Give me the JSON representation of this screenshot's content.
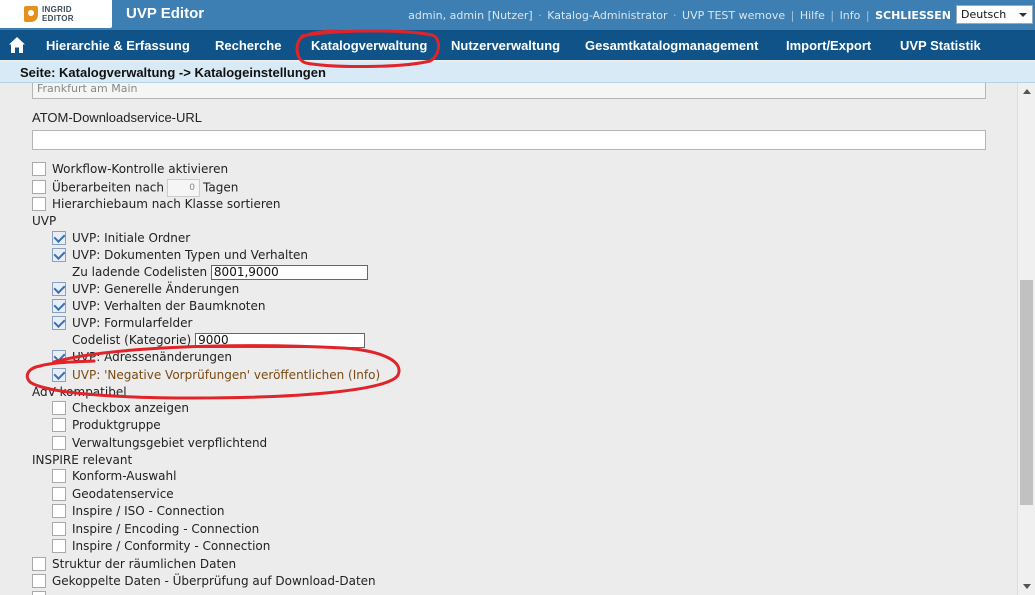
{
  "app": {
    "logo_line1": "INGRID",
    "logo_line2": "EDITOR",
    "title": "UVP Editor"
  },
  "header": {
    "user": "admin, admin [Nutzer]",
    "role": "Katalog-Administrator",
    "catalog": "UVP TEST wemove",
    "help": "Hilfe",
    "info": "Info",
    "close": "SCHLIESSEN",
    "language": "Deutsch"
  },
  "nav": {
    "items": [
      {
        "label": "Hierarchie & Erfassung"
      },
      {
        "label": "Recherche"
      },
      {
        "label": "Katalogverwaltung"
      },
      {
        "label": "Nutzerverwaltung"
      },
      {
        "label": "Gesamtkatalogmanagement"
      },
      {
        "label": "Import/Export"
      },
      {
        "label": "UVP Statistik"
      }
    ]
  },
  "breadcrumb": "Seite: Katalogverwaltung -> Katalogeinstellungen",
  "form": {
    "prev_field_value": "Frankfurt am Main",
    "atom_label": "ATOM-Downloadservice-URL",
    "atom_value": "",
    "workflow": "Workflow-Kontrolle aktivieren",
    "rework_before": "Überarbeiten nach",
    "rework_days": "0",
    "rework_after": "Tagen",
    "sort_tree": "Hierarchiebaum nach Klasse sortieren",
    "uvp_section": "UVP",
    "uvp_initial_folders": "UVP: Initiale Ordner",
    "uvp_doc_types": "UVP: Dokumenten Typen und Verhalten",
    "codelists_label": "Zu ladende Codelisten",
    "codelists_value": "8001,9000",
    "uvp_general": "UVP: Generelle Änderungen",
    "uvp_tree_behavior": "UVP: Verhalten der Baumknoten",
    "uvp_form_fields": "UVP: Formularfelder",
    "codelist_category_label": "Codelist (Kategorie)",
    "codelist_category_value": "9000",
    "uvp_address": "UVP: Adressenänderungen",
    "uvp_negative": "UVP: 'Negative Vorprüfungen' veröffentlichen (Info)",
    "adv_section": "AdV kompatibel",
    "adv_checkbox": "Checkbox anzeigen",
    "adv_product_group": "Produktgruppe",
    "adv_admin_area": "Verwaltungsgebiet verpflichtend",
    "inspire_section": "INSPIRE relevant",
    "inspire_conform": "Konform-Auswahl",
    "inspire_geodata": "Geodatenservice",
    "inspire_iso": "Inspire / ISO - Connection",
    "inspire_encoding": "Inspire / Encoding - Connection",
    "inspire_conformity": "Inspire / Conformity - Connection",
    "spatial_structure": "Struktur der räumlichen Daten",
    "coupled_data": "Gekoppelte Daten - Überprüfung auf Download-Daten"
  },
  "colors": {
    "topbar": "#3d7fb3",
    "navbar": "#0f5389",
    "annotation": "#e0242a"
  }
}
